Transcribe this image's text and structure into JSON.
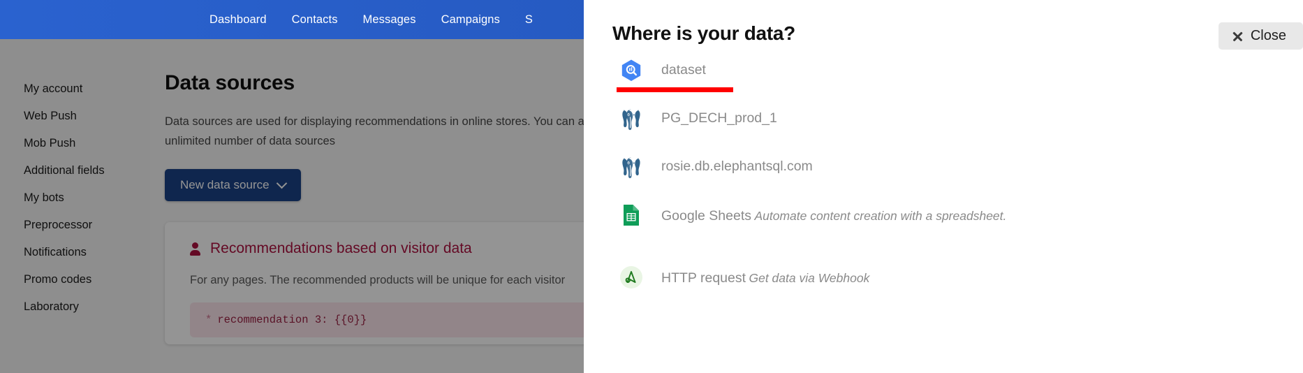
{
  "topnav": {
    "items": [
      {
        "label": "Dashboard"
      },
      {
        "label": "Contacts"
      },
      {
        "label": "Messages"
      },
      {
        "label": "Campaigns"
      },
      {
        "label": "S"
      }
    ]
  },
  "sidebar": {
    "items": [
      {
        "label": "My account"
      },
      {
        "label": "Web Push"
      },
      {
        "label": "Mob Push"
      },
      {
        "label": "Additional fields"
      },
      {
        "label": "My bots"
      },
      {
        "label": "Preprocessor"
      },
      {
        "label": "Notifications"
      },
      {
        "label": "Promo codes"
      },
      {
        "label": "Laboratory"
      }
    ]
  },
  "main": {
    "title": "Data sources",
    "description": "Data sources are used for displaying recommendations in online stores. You can add an unlimited number of data sources",
    "new_source_button": "New data source",
    "card": {
      "title": "Recommendations based on visitor data",
      "subtitle": "For any pages. The recommended products will be unique for each visitor",
      "code_star": "*",
      "code": "recommendation 3: {{0}}"
    }
  },
  "modal": {
    "title": "Where is your data?",
    "close_label": "Close",
    "sources": [
      {
        "label": "dataset",
        "desc": "",
        "icon": "bigquery-icon",
        "selected": true
      },
      {
        "label": "PG_DECH_prod_1",
        "desc": "",
        "icon": "postgresql-icon",
        "selected": false
      },
      {
        "label": "rosie.db.elephantsql.com",
        "desc": "",
        "icon": "postgresql-icon",
        "selected": false
      },
      {
        "label": "Google Sheets",
        "desc": "Automate content creation with a spreadsheet.",
        "icon": "google-sheets-icon",
        "selected": false
      },
      {
        "label": "HTTP request",
        "desc": "Get data via Webhook",
        "icon": "http-request-icon",
        "selected": false
      }
    ]
  },
  "colors": {
    "nav_blue": "#2558be",
    "primary_button": "#1b4287",
    "accent_red": "#ff0000",
    "card_accent": "#ad1240",
    "bigquery_blue": "#4285f4",
    "postgres_blue": "#31648c",
    "sheets_green": "#0f9d58"
  }
}
